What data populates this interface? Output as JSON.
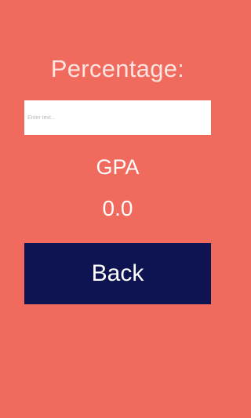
{
  "header": {
    "title": "Percentage:"
  },
  "percentage_input": {
    "placeholder": "Enter text...",
    "value": ""
  },
  "gpa": {
    "label": "GPA",
    "value": "0.0"
  },
  "back_button": {
    "label": "Back"
  },
  "colors": {
    "background": "#f06a5d",
    "button": "#0e1452",
    "title_text": "#fbe4e0",
    "text": "#ffffff"
  }
}
